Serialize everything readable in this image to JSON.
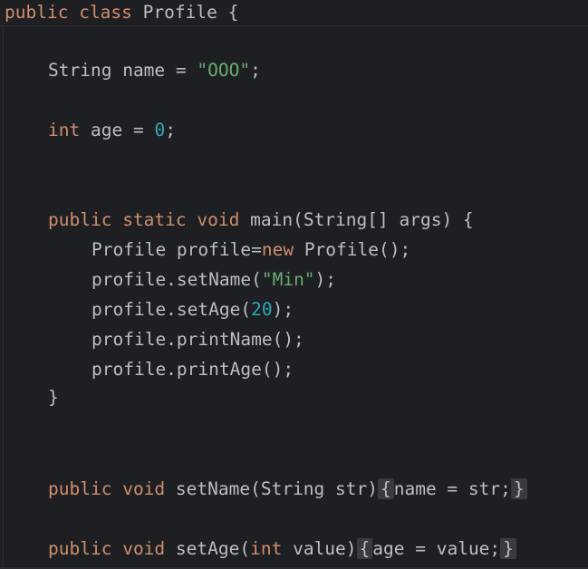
{
  "code": {
    "line1": {
      "kw_public": "public",
      "kw_class": "class",
      "class_name": "Profile",
      "brace": "{"
    },
    "line2": {
      "type": "String",
      "rest1": "name = ",
      "value": "\"OOO\"",
      "end": ";"
    },
    "line3": {
      "kw_int": "int",
      "rest1": "age = ",
      "value": "0",
      "end": ";"
    },
    "line4": {
      "kw_public": "public",
      "kw_static": "static",
      "kw_void": "void",
      "sig": "main(String[] args) {"
    },
    "line5": {
      "pre": "Profile profile=",
      "kw_new": "new",
      "post": " Profile();"
    },
    "line6": {
      "pre": "profile.setName(",
      "value": "\"Min\"",
      "post": ");"
    },
    "line7": {
      "pre": "profile.setAge(",
      "value": "20",
      "post": ");"
    },
    "line8": {
      "text": "profile.printName();"
    },
    "line9": {
      "text": "profile.printAge();"
    },
    "line10": {
      "text": "}"
    },
    "line11": {
      "kw_public": "public",
      "kw_void": "void",
      "sig": "setName(String str)",
      "fold_open": "{",
      "body": "name = str;",
      "fold_close": "}"
    },
    "line12": {
      "kw_public": "public",
      "kw_void": "void",
      "sig_pre": "setAge(",
      "kw_int": "int",
      "sig_post": " value)",
      "fold_open": "{",
      "body": "age = value;",
      "fold_close": "}"
    }
  },
  "colors": {
    "background": "#1e1f22",
    "keyword": "#cf8e6d",
    "string": "#6aab73",
    "number": "#2aacb8",
    "default": "#bcbec4"
  }
}
